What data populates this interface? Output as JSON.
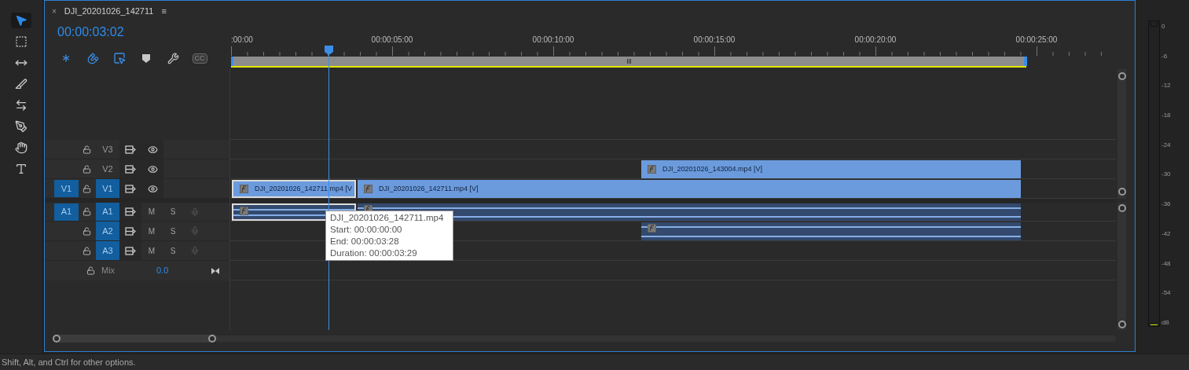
{
  "tools": [
    {
      "kind": "select",
      "selected": true
    },
    {
      "kind": "track-select",
      "selected": false
    },
    {
      "kind": "ripple",
      "selected": false
    },
    {
      "kind": "razor",
      "selected": false
    },
    {
      "kind": "slip",
      "selected": false
    },
    {
      "kind": "pen",
      "selected": false
    },
    {
      "kind": "hand",
      "selected": false
    },
    {
      "kind": "type",
      "selected": false
    }
  ],
  "sequence": {
    "close": "×",
    "title": "DJI_20201026_142711",
    "menu": "≡",
    "timecode": "00:00:03:02"
  },
  "timeline_tools": [
    {
      "kind": "nest",
      "on": true
    },
    {
      "kind": "snap",
      "on": true
    },
    {
      "kind": "linked",
      "on": true
    },
    {
      "kind": "marker",
      "on": false
    },
    {
      "kind": "settings",
      "on": false
    },
    {
      "kind": "captions",
      "label": "CC",
      "disabled": true
    }
  ],
  "ruler": {
    "labels": [
      ":00:00",
      "00:00:05:00",
      "00:00:10:00",
      "00:00:15:00",
      "00:00:20:00",
      "00:00:25:00"
    ]
  },
  "tracks": [
    {
      "kind": "video",
      "name": "V3",
      "targeted": false
    },
    {
      "kind": "video",
      "name": "V2",
      "targeted": false,
      "clips": [
        {
          "label": "DJI_20201026_143004.mp4 [V]",
          "selected": false
        }
      ]
    },
    {
      "kind": "video",
      "name": "V1",
      "source": "V1",
      "targeted": true,
      "clips": [
        {
          "label": "DJI_20201026_142711.mp4 [V",
          "selected": true
        },
        {
          "label": "DJI_20201026_142711.mp4 [V]",
          "selected": false
        }
      ]
    },
    {
      "kind": "audio",
      "name": "A1",
      "source": "A1",
      "targeted": true,
      "mute": "M",
      "solo": "S",
      "clips": [
        {
          "selected": true
        },
        {
          "selected": false
        }
      ]
    },
    {
      "kind": "audio",
      "name": "A2",
      "targeted": true,
      "mute": "M",
      "solo": "S",
      "clips": [
        {
          "selected": false
        }
      ]
    },
    {
      "kind": "audio",
      "name": "A3",
      "targeted": true,
      "mute": "M",
      "solo": "S"
    }
  ],
  "mix": {
    "label": "Mix",
    "value": "0.0"
  },
  "tooltip": {
    "lines": [
      "DJI_20201026_142711.mp4",
      "Start: 00:00:00:00",
      "End: 00:00:03:28",
      "Duration: 00:00:03:29"
    ]
  },
  "meter": {
    "labels": [
      "0",
      "-6",
      "-12",
      "-18",
      "-24",
      "-30",
      "-36",
      "-42",
      "-48",
      "-54",
      "dB"
    ]
  },
  "status_bar": "Shift, Alt, and Ctrl for other options."
}
